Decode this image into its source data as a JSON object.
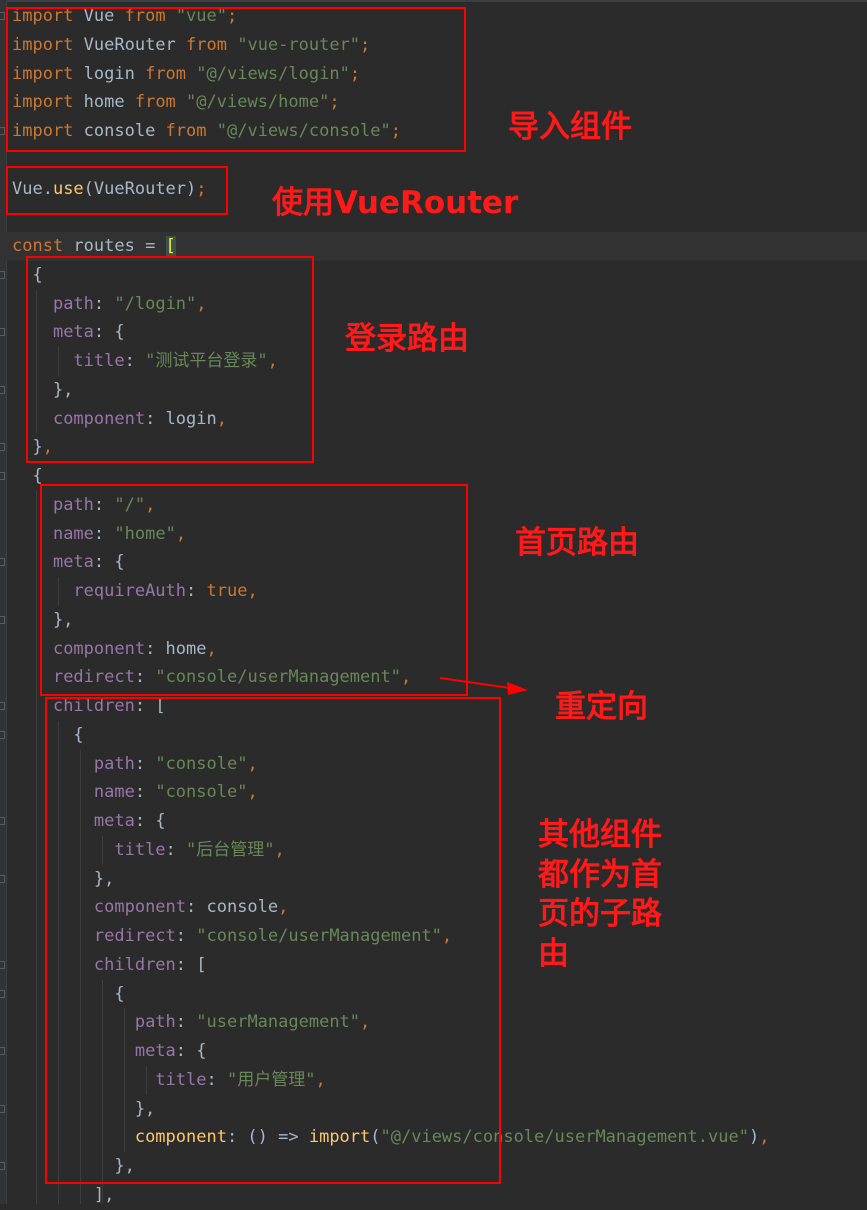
{
  "code": [
    [
      [
        "kw",
        "import"
      ],
      [
        "pl",
        " Vue "
      ],
      [
        "kw",
        "from"
      ],
      [
        "pl",
        " "
      ],
      [
        "str",
        "\"vue\""
      ],
      [
        "kw",
        ";"
      ]
    ],
    [
      [
        "kw",
        "import"
      ],
      [
        "pl",
        " VueRouter "
      ],
      [
        "kw",
        "from"
      ],
      [
        "pl",
        " "
      ],
      [
        "str",
        "\"vue-router\""
      ],
      [
        "kw",
        ";"
      ]
    ],
    [
      [
        "kw",
        "import"
      ],
      [
        "pl",
        " login "
      ],
      [
        "kw",
        "from"
      ],
      [
        "pl",
        " "
      ],
      [
        "str",
        "\"@/views/login\""
      ],
      [
        "kw",
        ";"
      ]
    ],
    [
      [
        "kw",
        "import"
      ],
      [
        "pl",
        " home "
      ],
      [
        "kw",
        "from"
      ],
      [
        "pl",
        " "
      ],
      [
        "str",
        "\"@/views/home\""
      ],
      [
        "kw",
        ";"
      ]
    ],
    [
      [
        "kw",
        "import"
      ],
      [
        "pl",
        " console "
      ],
      [
        "kw",
        "from"
      ],
      [
        "pl",
        " "
      ],
      [
        "str",
        "\"@/views/console\""
      ],
      [
        "kw",
        ";"
      ]
    ],
    [],
    [
      [
        "pl",
        "Vue."
      ],
      [
        "fn",
        "use"
      ],
      [
        "pl",
        "(VueRouter)"
      ],
      [
        "kw",
        ";"
      ]
    ],
    [],
    [
      [
        "kw",
        "const"
      ],
      [
        "pl",
        " routes = "
      ],
      [
        "bh",
        "["
      ]
    ],
    [
      [
        "pl",
        "  {"
      ]
    ],
    [
      [
        "pl",
        "    "
      ],
      [
        "prop",
        "path"
      ],
      [
        "pl",
        ": "
      ],
      [
        "str",
        "\"/login\""
      ],
      [
        "kw",
        ","
      ]
    ],
    [
      [
        "pl",
        "    "
      ],
      [
        "prop",
        "meta"
      ],
      [
        "pl",
        ": {"
      ]
    ],
    [
      [
        "pl",
        "      "
      ],
      [
        "prop",
        "title"
      ],
      [
        "pl",
        ": "
      ],
      [
        "str",
        "\"测试平台登录\""
      ],
      [
        "kw",
        ","
      ]
    ],
    [
      [
        "pl",
        "    },"
      ]
    ],
    [
      [
        "pl",
        "    "
      ],
      [
        "prop",
        "component"
      ],
      [
        "pl",
        ": login"
      ],
      [
        "kw",
        ","
      ]
    ],
    [
      [
        "pl",
        "  }"
      ],
      [
        "kw",
        ","
      ]
    ],
    [
      [
        "pl",
        "  {"
      ]
    ],
    [
      [
        "pl",
        "    "
      ],
      [
        "prop",
        "path"
      ],
      [
        "pl",
        ": "
      ],
      [
        "str",
        "\"/\""
      ],
      [
        "kw",
        ","
      ]
    ],
    [
      [
        "pl",
        "    "
      ],
      [
        "prop",
        "name"
      ],
      [
        "pl",
        ": "
      ],
      [
        "str",
        "\"home\""
      ],
      [
        "kw",
        ","
      ]
    ],
    [
      [
        "pl",
        "    "
      ],
      [
        "prop",
        "meta"
      ],
      [
        "pl",
        ": {"
      ]
    ],
    [
      [
        "pl",
        "      "
      ],
      [
        "prop",
        "requireAuth"
      ],
      [
        "pl",
        ": "
      ],
      [
        "kw",
        "true"
      ],
      [
        "kw",
        ","
      ]
    ],
    [
      [
        "pl",
        "    },"
      ]
    ],
    [
      [
        "pl",
        "    "
      ],
      [
        "prop",
        "component"
      ],
      [
        "pl",
        ": home"
      ],
      [
        "kw",
        ","
      ]
    ],
    [
      [
        "pl",
        "    "
      ],
      [
        "prop",
        "redirect"
      ],
      [
        "pl",
        ": "
      ],
      [
        "str",
        "\"console/userManagement\""
      ],
      [
        "kw",
        ","
      ]
    ],
    [
      [
        "pl",
        "    "
      ],
      [
        "prop",
        "children"
      ],
      [
        "pl",
        ": ["
      ]
    ],
    [
      [
        "pl",
        "      {"
      ]
    ],
    [
      [
        "pl",
        "        "
      ],
      [
        "prop",
        "path"
      ],
      [
        "pl",
        ": "
      ],
      [
        "str",
        "\"console\""
      ],
      [
        "kw",
        ","
      ]
    ],
    [
      [
        "pl",
        "        "
      ],
      [
        "prop",
        "name"
      ],
      [
        "pl",
        ": "
      ],
      [
        "str",
        "\"console\""
      ],
      [
        "kw",
        ","
      ]
    ],
    [
      [
        "pl",
        "        "
      ],
      [
        "prop",
        "meta"
      ],
      [
        "pl",
        ": {"
      ]
    ],
    [
      [
        "pl",
        "          "
      ],
      [
        "prop",
        "title"
      ],
      [
        "pl",
        ": "
      ],
      [
        "str",
        "\"后台管理\""
      ],
      [
        "kw",
        ","
      ]
    ],
    [
      [
        "pl",
        "        },"
      ]
    ],
    [
      [
        "pl",
        "        "
      ],
      [
        "prop",
        "component"
      ],
      [
        "pl",
        ": console"
      ],
      [
        "kw",
        ","
      ]
    ],
    [
      [
        "pl",
        "        "
      ],
      [
        "prop",
        "redirect"
      ],
      [
        "pl",
        ": "
      ],
      [
        "str",
        "\"console/userManagement\""
      ],
      [
        "kw",
        ","
      ]
    ],
    [
      [
        "pl",
        "        "
      ],
      [
        "prop",
        "children"
      ],
      [
        "pl",
        ": ["
      ]
    ],
    [
      [
        "pl",
        "          {"
      ]
    ],
    [
      [
        "pl",
        "            "
      ],
      [
        "prop",
        "path"
      ],
      [
        "pl",
        ": "
      ],
      [
        "str",
        "\"userManagement\""
      ],
      [
        "kw",
        ","
      ]
    ],
    [
      [
        "pl",
        "            "
      ],
      [
        "prop",
        "meta"
      ],
      [
        "pl",
        ": {"
      ]
    ],
    [
      [
        "pl",
        "              "
      ],
      [
        "prop",
        "title"
      ],
      [
        "pl",
        ": "
      ],
      [
        "str",
        "\"用户管理\""
      ],
      [
        "kw",
        ","
      ]
    ],
    [
      [
        "pl",
        "            },"
      ]
    ],
    [
      [
        "pl",
        "            "
      ],
      [
        "fn",
        "component"
      ],
      [
        "pl",
        ": () => "
      ],
      [
        "fn",
        "import"
      ],
      [
        "pl",
        "("
      ],
      [
        "str",
        "\"@/views/console/userManagement.vue\""
      ],
      [
        "pl",
        ")"
      ],
      [
        "kw",
        ","
      ]
    ],
    [
      [
        "pl",
        "          },"
      ]
    ],
    [
      [
        "pl",
        "        ],"
      ]
    ]
  ],
  "annotations": {
    "imports": "导入组件",
    "use_router": "使用VueRouter",
    "login_route": "登录路由",
    "home_route": "首页路由",
    "redirect": "重定向",
    "children": "其他组件\n都作为首\n页的子路\n由"
  },
  "colors": {
    "background": "#2b2b2b",
    "keyword": "#cc7832",
    "string": "#6a8759",
    "property": "#9876aa",
    "function": "#ffc66d",
    "plain": "#a9b7c6",
    "annotation": "#ff0000"
  }
}
